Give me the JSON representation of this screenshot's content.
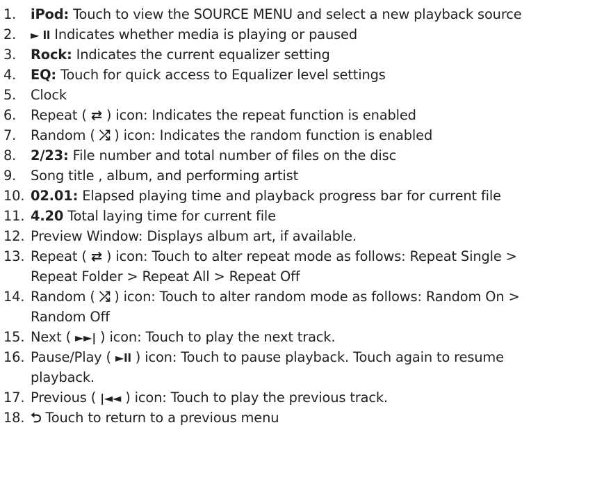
{
  "items": [
    {
      "num": "1.",
      "label": "iPod:",
      "text": " Touch to view the SOURCE MENU and select a new playback source"
    },
    {
      "num": "2.",
      "icon": "play-pause-icon",
      "glyph": "► ll",
      "text": " Indicates whether media is playing or paused"
    },
    {
      "num": "3.",
      "label": "Rock:",
      "text": " Indicates the current equalizer setting"
    },
    {
      "num": "4.",
      "label": "EQ:",
      "text": " Touch for quick access to Equalizer level settings"
    },
    {
      "num": "5.",
      "text": "Clock"
    },
    {
      "num": "6.",
      "pre": "Repeat ( ",
      "icon": "repeat-icon",
      "glyph": "⇄",
      "text": " ) icon: Indicates the repeat function is enabled"
    },
    {
      "num": "7.",
      "pre": "Random ( ",
      "icon": "random-icon",
      "glyph": "⤮",
      "text": " ) icon: Indicates the random function is enabled"
    },
    {
      "num": "8.",
      "label": "2/23:",
      "text": " File number and total number of files on the disc"
    },
    {
      "num": "9.",
      "text": "Song title , album, and performing artist"
    },
    {
      "num": "10.",
      "label": "02.01:",
      "text": " Elapsed playing time and playback progress bar for current file"
    },
    {
      "num": "11.",
      "label": "4.20",
      "text": " Total laying time for current file"
    },
    {
      "num": "12.",
      "text": " Preview Window: Displays album art, if available."
    },
    {
      "num": "13.",
      "pre": "Repeat ( ",
      "icon": "repeat-icon",
      "glyph": "⇄",
      "text": " ) icon: Touch to alter repeat mode as follows: Repeat Single >",
      "cont": "Repeat Folder > Repeat All > Repeat Off"
    },
    {
      "num": "14.",
      "pre": "Random ( ",
      "icon": "random-icon",
      "glyph": "⤮",
      "text": " ) icon: Touch to alter random mode as follows: Random On >",
      "cont": "Random Off"
    },
    {
      "num": "15.",
      "pre": "Next ( ",
      "icon": "next-icon",
      "glyph": "►►|",
      "text": " ) icon: Touch to play the next track."
    },
    {
      "num": "16.",
      "pre": "Pause/Play ( ",
      "icon": "play-pause-icon",
      "glyph": "►ll",
      "text": " ) icon: Touch to pause playback. Touch again to resume",
      "cont": "playback."
    },
    {
      "num": "17.",
      "pre": "Previous ( ",
      "icon": "previous-icon",
      "glyph": "|◄◄",
      "text": " ) icon: Touch to play the previous track."
    },
    {
      "num": "18.",
      "icon": "return-icon",
      "glyph": "⮌",
      "text": " Touch to return to a previous menu"
    }
  ]
}
